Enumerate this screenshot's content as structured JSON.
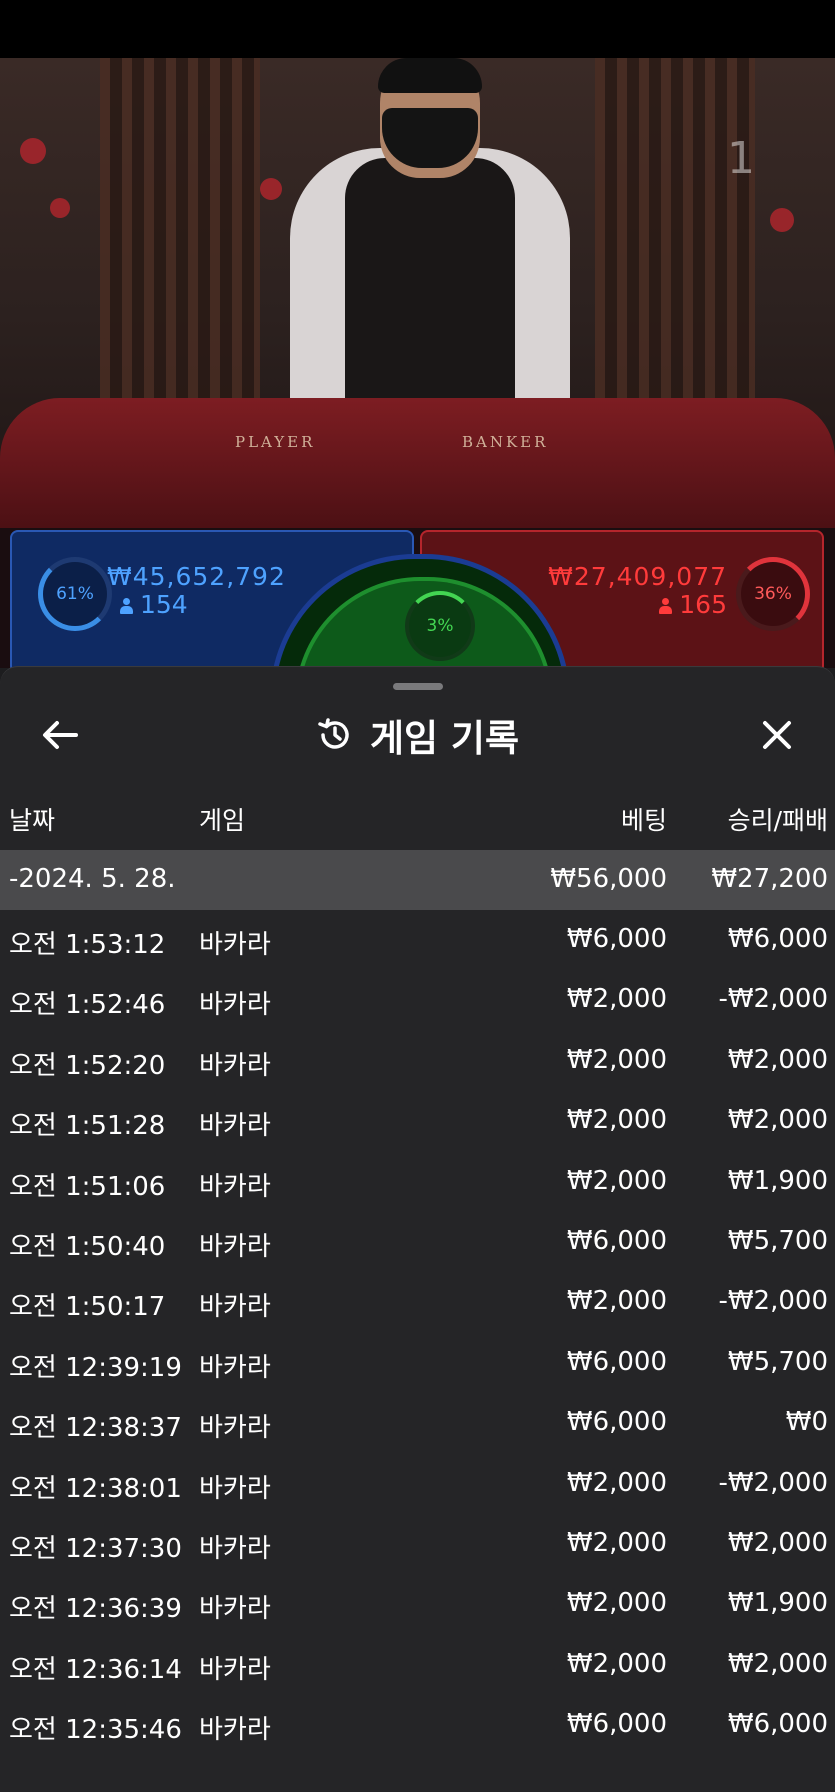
{
  "video": {
    "counter": "1",
    "felt_player": "PLAYER",
    "felt_banker": "BANKER"
  },
  "bets": {
    "player": {
      "percent": "61%",
      "amount": "₩45,652,792",
      "count": "154"
    },
    "banker": {
      "percent": "36%",
      "amount": "₩27,409,077",
      "count": "165"
    },
    "tie": {
      "percent": "3%"
    }
  },
  "sheet": {
    "title": "게임 기록",
    "headers": {
      "date": "날짜",
      "game": "게임",
      "bet": "베팅",
      "result": "승리/패배"
    },
    "day": {
      "label": "-2024. 5. 28.",
      "bet": "₩56,000",
      "result": "₩27,200"
    },
    "rows": [
      {
        "time": "오전 1:53:12",
        "game": "바카라",
        "bet": "₩6,000",
        "result": "₩6,000"
      },
      {
        "time": "오전 1:52:46",
        "game": "바카라",
        "bet": "₩2,000",
        "result": "-₩2,000"
      },
      {
        "time": "오전 1:52:20",
        "game": "바카라",
        "bet": "₩2,000",
        "result": "₩2,000"
      },
      {
        "time": "오전 1:51:28",
        "game": "바카라",
        "bet": "₩2,000",
        "result": "₩2,000"
      },
      {
        "time": "오전 1:51:06",
        "game": "바카라",
        "bet": "₩2,000",
        "result": "₩1,900"
      },
      {
        "time": "오전 1:50:40",
        "game": "바카라",
        "bet": "₩6,000",
        "result": "₩5,700"
      },
      {
        "time": "오전 1:50:17",
        "game": "바카라",
        "bet": "₩2,000",
        "result": "-₩2,000"
      },
      {
        "time": "오전 12:39:19",
        "game": "바카라",
        "bet": "₩6,000",
        "result": "₩5,700"
      },
      {
        "time": "오전 12:38:37",
        "game": "바카라",
        "bet": "₩6,000",
        "result": "₩0"
      },
      {
        "time": "오전 12:38:01",
        "game": "바카라",
        "bet": "₩2,000",
        "result": "-₩2,000"
      },
      {
        "time": "오전 12:37:30",
        "game": "바카라",
        "bet": "₩2,000",
        "result": "₩2,000"
      },
      {
        "time": "오전 12:36:39",
        "game": "바카라",
        "bet": "₩2,000",
        "result": "₩1,900"
      },
      {
        "time": "오전 12:36:14",
        "game": "바카라",
        "bet": "₩2,000",
        "result": "₩2,000"
      },
      {
        "time": "오전 12:35:46",
        "game": "바카라",
        "bet": "₩6,000",
        "result": "₩6,000"
      }
    ]
  },
  "icons": {
    "back": "arrow-left-icon",
    "history": "history-clock-icon",
    "close": "close-icon",
    "user": "person-icon"
  },
  "colors": {
    "player": "#4ea2ff",
    "banker": "#ff3b3b",
    "tie": "#43d552",
    "sheet_bg": "#262628"
  }
}
